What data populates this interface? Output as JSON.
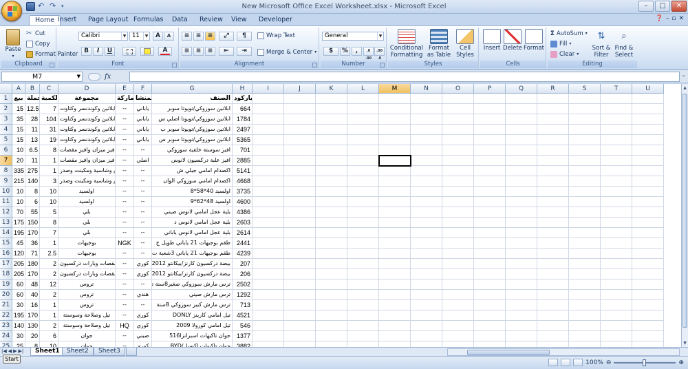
{
  "window": {
    "title": "New Microsoft Office Excel Worksheet.xlsx - Microsoft Excel",
    "min": "–",
    "max": "□",
    "close": "✕"
  },
  "tabs": [
    "Home",
    "Insert",
    "Page Layout",
    "Formulas",
    "Data",
    "Review",
    "View",
    "Developer"
  ],
  "active_tab": "Home",
  "ribbon": {
    "clipboard": {
      "label": "Clipboard",
      "paste": "Paste",
      "cut": "Cut",
      "copy": "Copy",
      "format_painter": "Format Painter"
    },
    "font": {
      "label": "Font",
      "name": "Calibri",
      "size": "11",
      "bold": "B",
      "italic": "I",
      "underline": "U",
      "grow": "A",
      "shrink": "A"
    },
    "alignment": {
      "label": "Alignment",
      "wrap": "Wrap Text",
      "merge": "Merge & Center"
    },
    "number": {
      "label": "Number",
      "format": "General",
      "currency": "$",
      "percent": "%",
      "comma": ",",
      "inc_decimal": ".0 .00",
      "dec_decimal": ".00 .0"
    },
    "styles": {
      "label": "Styles",
      "conditional": "Conditional Formatting",
      "format_table": "Format as Table",
      "cell_styles": "Cell Styles"
    },
    "cells": {
      "label": "Cells",
      "insert": "Insert",
      "delete": "Delete",
      "format": "Format"
    },
    "editing": {
      "label": "Editing",
      "autosum": "AutoSum",
      "fill": "Fill",
      "clear": "Clear",
      "sort": "Sort & Filter",
      "find": "Find & Select"
    }
  },
  "formula_bar": {
    "name_box": "M7",
    "fx": "fx",
    "content": ""
  },
  "columns": [
    "A",
    "B",
    "C",
    "D",
    "E",
    "F",
    "G",
    "H",
    "I",
    "J",
    "K",
    "L",
    "M",
    "N",
    "O",
    "P",
    "Q",
    "R",
    "S",
    "T",
    "U"
  ],
  "selected_column": "M",
  "selected_row": 7,
  "rows": [
    {
      "n": "1",
      "A": "بيع",
      "B": "جملة",
      "C": "الكمية",
      "D": "مجموعة",
      "E": "الماركة",
      "F": "المنشا",
      "G": "الصنف",
      "H": "باركود"
    },
    {
      "n": "2",
      "A": "15",
      "B": "12.5",
      "C": "7",
      "D": "ابلاتين وكوندنسر وكتاوت",
      "E": "--",
      "F": "ياباني",
      "G": "ابلاتين سوزوكي/تويوتا سوبر",
      "H": "664"
    },
    {
      "n": "3",
      "A": "35",
      "B": "28",
      "C": "104",
      "D": "ابلاتين وكوندنسر وكتاوت",
      "E": "--",
      "F": "ياباني",
      "G": "ابلاتين سوزوكي/تويوتا اصلي س",
      "H": "1784"
    },
    {
      "n": "4",
      "A": "15",
      "B": "11",
      "C": "31",
      "D": "ابلاتين وكوندنسر وكتاوت",
      "E": "--",
      "F": "ياباني",
      "G": "ابلاتين سوزوكي/تويوتا سوبر ب",
      "H": "2497"
    },
    {
      "n": "5",
      "A": "15",
      "B": "13",
      "C": "19",
      "D": "ابلاتين وكوندنسر وكتاوت",
      "E": "--",
      "F": "ياباني",
      "G": "ابلاتين سوزوكي/تويوتا سوبر س",
      "H": "5365"
    },
    {
      "n": "6",
      "A": "10",
      "B": "6.5",
      "C": "8",
      "D": "افيز ميزان وافيز مقصات",
      "E": "--",
      "F": "--",
      "G": "افيز سوستة خلفية سوزوكي",
      "H": "701"
    },
    {
      "n": "7",
      "A": "20",
      "B": "11",
      "C": "1",
      "D": "افيز ميزان وافيز مقصات",
      "E": "--",
      "F": "اصلي",
      "G": "افيز علبة دركسيون لانوس",
      "H": "2885"
    },
    {
      "n": "8",
      "A": "335",
      "B": "275",
      "C": "1",
      "D": "اكصدام وشاسية ومكينت وصدر",
      "E": "--",
      "F": "--",
      "G": "اكصدام امامي جيلي ش",
      "H": "5141"
    },
    {
      "n": "9",
      "A": "215",
      "B": "140",
      "C": "3",
      "D": "اكصدام وشاسية ومكينت وصدر",
      "E": "--",
      "F": "--",
      "G": "اكصدام امامي سوزوكي الوان",
      "H": "4668"
    },
    {
      "n": "10",
      "A": "10",
      "B": "8",
      "C": "10",
      "D": "اولسيد",
      "E": "--",
      "F": "--",
      "G": "اولسيد 40*58*8",
      "H": "3735"
    },
    {
      "n": "11",
      "A": "10",
      "B": "6",
      "C": "10",
      "D": "اولسيد",
      "E": "--",
      "F": "--",
      "G": "اولسيد 48*62*9",
      "H": "4600"
    },
    {
      "n": "12",
      "A": "70",
      "B": "55",
      "C": "5",
      "D": "بلي",
      "E": "--",
      "F": "--",
      "G": "بلية عجل امامي لانوس صيني",
      "H": "4386"
    },
    {
      "n": "13",
      "A": "175",
      "B": "150",
      "C": "8",
      "D": "بلي",
      "E": "--",
      "F": "--",
      "G": "بلية عجل امامي لانوس د",
      "H": "2603"
    },
    {
      "n": "14",
      "A": "195",
      "B": "170",
      "C": "7",
      "D": "بلي",
      "E": "--",
      "F": "--",
      "G": "بلية عجل امامي لانوس ياباني",
      "H": "2614"
    },
    {
      "n": "15",
      "A": "45",
      "B": "36",
      "C": "1",
      "D": "بوجيهات",
      "E": "NGK",
      "F": "--",
      "G": "طقم بوجيهات 21 ياباني طويل ج",
      "H": "2441"
    },
    {
      "n": "16",
      "A": "120",
      "B": "71",
      "C": "2.5",
      "D": "بوجيهات",
      "E": "--",
      "F": "--",
      "G": "طقم بوجيهات 21 ياباني 3شعبة ت",
      "H": "4239"
    },
    {
      "n": "17",
      "A": "205",
      "B": "180",
      "C": "2",
      "D": "بيض مقصات وبارات دركسيون",
      "E": "--",
      "F": "كوري",
      "G": "بيضة دركسيون كارنز/بيكانتو L 2012",
      "H": "207"
    },
    {
      "n": "18",
      "A": "205",
      "B": "170",
      "C": "2",
      "D": "بيض مقصات وبارات دركسيون",
      "E": "--",
      "F": "كوري",
      "G": "بيضة دركسيون كارنز/بيكانتو R 2012",
      "H": "206"
    },
    {
      "n": "19",
      "A": "60",
      "B": "48",
      "C": "12",
      "D": "تروس",
      "E": "--",
      "F": "--",
      "G": "ترس مارش سوزوكي صغير8سنة تايواني",
      "H": "2502"
    },
    {
      "n": "20",
      "A": "60",
      "B": "40",
      "C": "2",
      "D": "تروس",
      "E": "--",
      "F": "هندي",
      "G": "ترس مارش صيني",
      "H": "1292"
    },
    {
      "n": "21",
      "A": "30",
      "B": "16",
      "C": "1",
      "D": "تروس",
      "E": "--",
      "F": "--",
      "G": "ترس مارش كبير سوزوكي 8سنة",
      "H": "713"
    },
    {
      "n": "22",
      "A": "195",
      "B": "170",
      "C": "1",
      "D": "تيل وصلاحة وسوستة",
      "E": "--",
      "F": "كوري",
      "G": "تيل امامي كارينز DONLY",
      "H": "4521"
    },
    {
      "n": "23",
      "A": "140",
      "B": "130",
      "C": "2",
      "D": "تيل وصلاحة وسوستة",
      "E": "HQ",
      "F": "كوري",
      "G": "تيل امامي كورولا 2009",
      "H": "546"
    },
    {
      "n": "24",
      "A": "30",
      "B": "20",
      "C": "6",
      "D": "جوان",
      "E": "--",
      "F": "صيني",
      "G": "جوان تاكيهات اسبرانزا516",
      "H": "1377"
    },
    {
      "n": "25",
      "A": "25",
      "B": "8",
      "C": "10",
      "D": "جوان",
      "E": "--",
      "F": "كوري",
      "G": "جوان تاكيهات اكسيل/BYD",
      "H": "3882"
    }
  ],
  "sheets": [
    "Sheet1",
    "Sheet2",
    "Sheet3"
  ],
  "active_sheet": "Sheet1",
  "status": {
    "start": "Start",
    "zoom": "100%"
  },
  "colors": {
    "accent": "#c3d6ee",
    "selected_header": "#f1c15f"
  }
}
